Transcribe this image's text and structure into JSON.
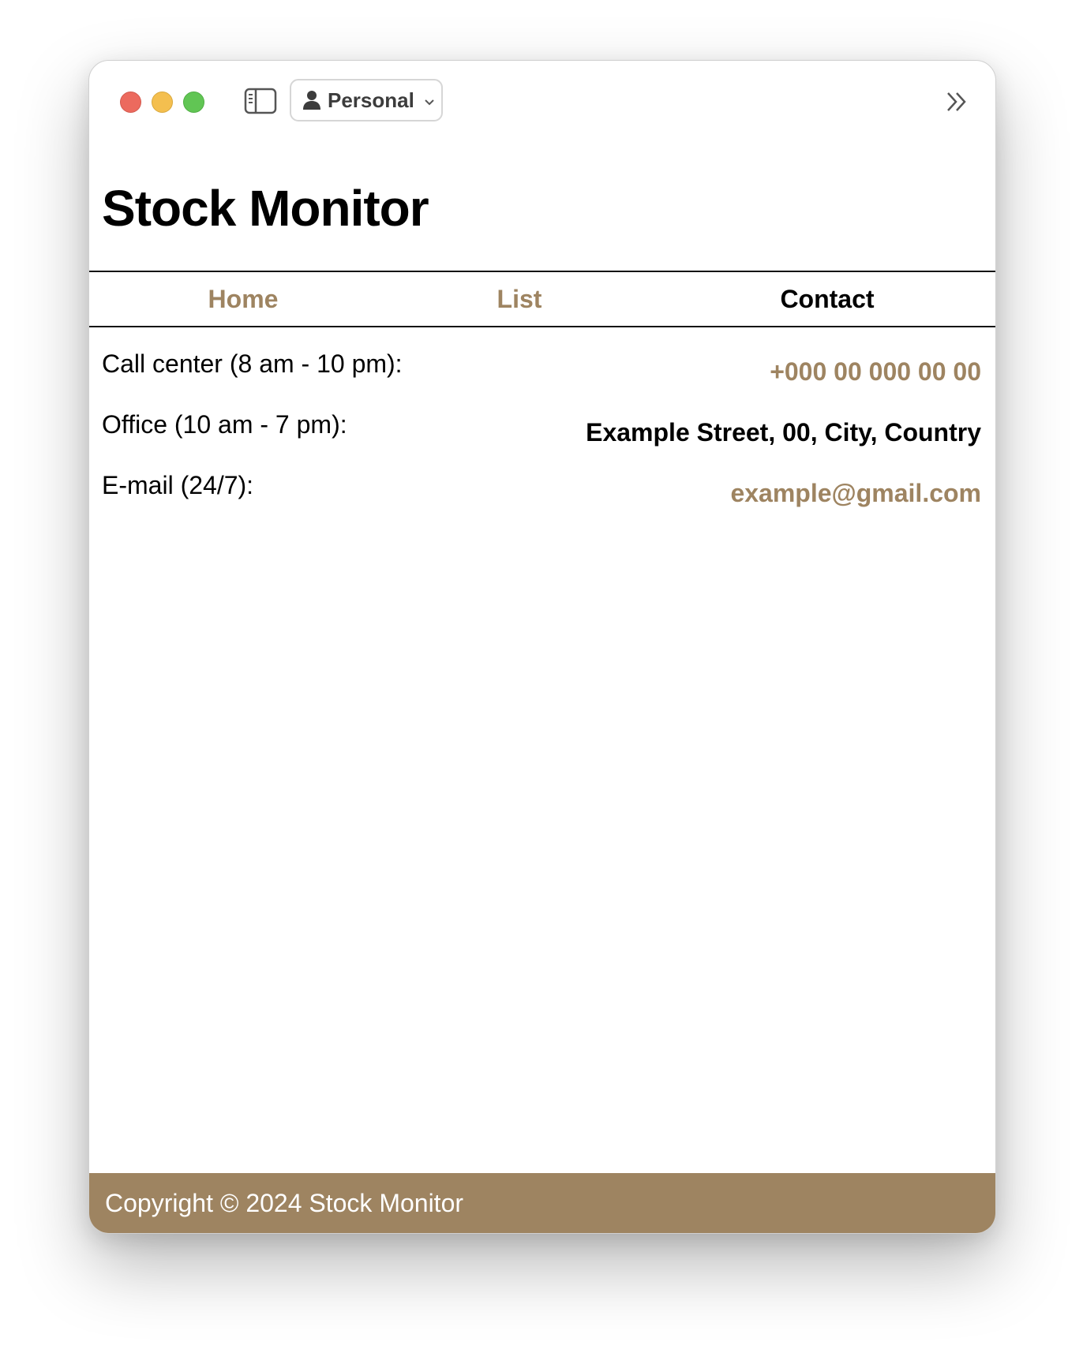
{
  "window": {
    "profile_label": "Personal"
  },
  "page": {
    "title": "Stock Monitor"
  },
  "nav": {
    "items": [
      {
        "label": "Home"
      },
      {
        "label": "List"
      },
      {
        "label": "Contact"
      }
    ],
    "active": "Contact"
  },
  "contact": {
    "rows": [
      {
        "label": "Call center (8 am - 10 pm):",
        "value": "+000 00 000 00 00"
      },
      {
        "label": "Office (10 am - 7 pm):",
        "value": "Example Street, 00, City, Country"
      },
      {
        "label": "E-mail (24/7):",
        "value": "example@gmail.com"
      }
    ]
  },
  "footer": {
    "copyright": "Copyright © 2024 Stock Monitor"
  },
  "colors": {
    "accent": "#9e8461",
    "text": "#000000",
    "footer_text": "#ffffff"
  },
  "icons": {
    "sidebar_toggle": "sidebar-icon",
    "profile": "person-icon",
    "profile_dropdown": "chevron-down-icon",
    "toolbar_overflow": "double-chevron-right-icon"
  }
}
